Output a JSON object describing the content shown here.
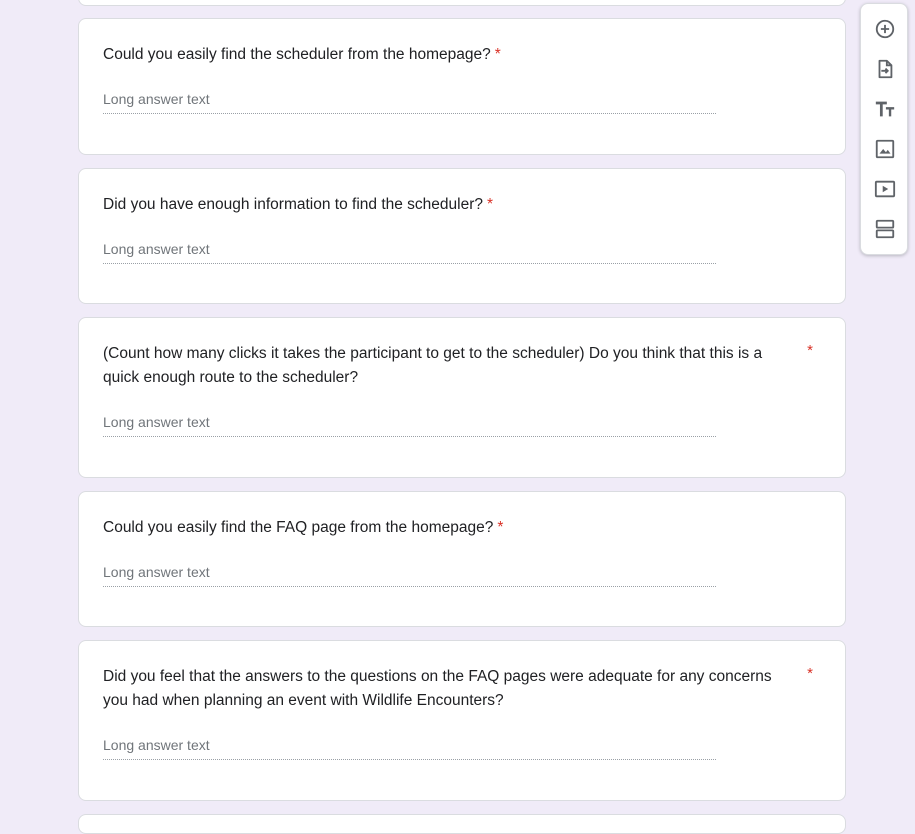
{
  "form": {
    "questions": [
      {
        "title": "Could you easily find the scheduler from the homepage?",
        "required_marker": "*",
        "placeholder": "Long answer text"
      },
      {
        "title": "Did you have enough information to find the scheduler?",
        "required_marker": "*",
        "placeholder": "Long answer text"
      },
      {
        "title": "(Count how many clicks it takes the participant to get to the scheduler) Do you think that this is a quick enough route to the scheduler?",
        "required_marker": "*",
        "placeholder": "Long answer text"
      },
      {
        "title": "Could you easily find the FAQ page from the homepage?",
        "required_marker": "*",
        "placeholder": "Long answer text"
      },
      {
        "title": "Did you feel that the answers to the questions on the FAQ pages were adequate for any concerns you had when planning an event with Wildlife Encounters?",
        "required_marker": "*",
        "placeholder": "Long answer text"
      }
    ]
  },
  "toolbar": {
    "items": [
      {
        "icon": "add-circle-icon"
      },
      {
        "icon": "import-questions-icon"
      },
      {
        "icon": "title-text-icon"
      },
      {
        "icon": "image-icon"
      },
      {
        "icon": "video-icon"
      },
      {
        "icon": "section-icon"
      }
    ]
  },
  "colors": {
    "background": "#f0ebf8",
    "required": "#d93025",
    "icon": "#5f6368"
  }
}
